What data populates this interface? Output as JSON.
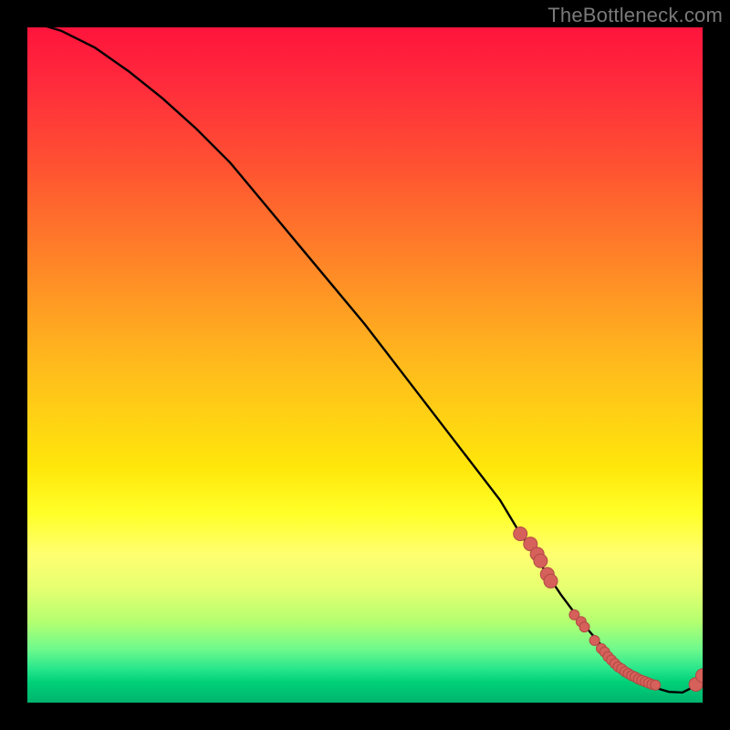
{
  "watermark": "TheBottleneck.com",
  "chart_data": {
    "type": "line",
    "title": "",
    "xlabel": "",
    "ylabel": "",
    "xlim": [
      0,
      100
    ],
    "ylim": [
      0,
      100
    ],
    "grid": false,
    "curve": {
      "x": [
        0,
        5,
        10,
        15,
        20,
        25,
        30,
        35,
        40,
        45,
        50,
        55,
        60,
        65,
        70,
        73,
        76,
        79,
        82,
        85,
        88,
        91,
        93,
        95,
        97,
        99,
        100
      ],
      "y": [
        101,
        99.5,
        97,
        93.5,
        89.5,
        85,
        80,
        74,
        68,
        62,
        56,
        49.5,
        43,
        36.5,
        30,
        25,
        20.5,
        16,
        12,
        8.5,
        5.5,
        3.3,
        2.2,
        1.6,
        1.5,
        2.5,
        4
      ]
    },
    "series": [
      {
        "name": "highlighted-points",
        "x": [
          73,
          74.5,
          75.5,
          76,
          77,
          77.5,
          81,
          82,
          82.5,
          84,
          85,
          85.5,
          86,
          86.5,
          87,
          87.5,
          88,
          88.5,
          89,
          89.5,
          90,
          90.5,
          91,
          91.5,
          92,
          92.5,
          93,
          99,
          100
        ],
        "y": [
          25,
          23.5,
          22,
          21,
          19,
          18,
          13,
          12,
          11.2,
          9.2,
          8,
          7.5,
          6.8,
          6.3,
          5.8,
          5.3,
          5,
          4.6,
          4.3,
          4,
          3.8,
          3.5,
          3.3,
          3.1,
          2.9,
          2.7,
          2.6,
          2.7,
          4
        ]
      }
    ]
  },
  "colors": {
    "curve": "#000000",
    "point_fill": "#d6605a",
    "point_stroke": "#b04a44"
  }
}
